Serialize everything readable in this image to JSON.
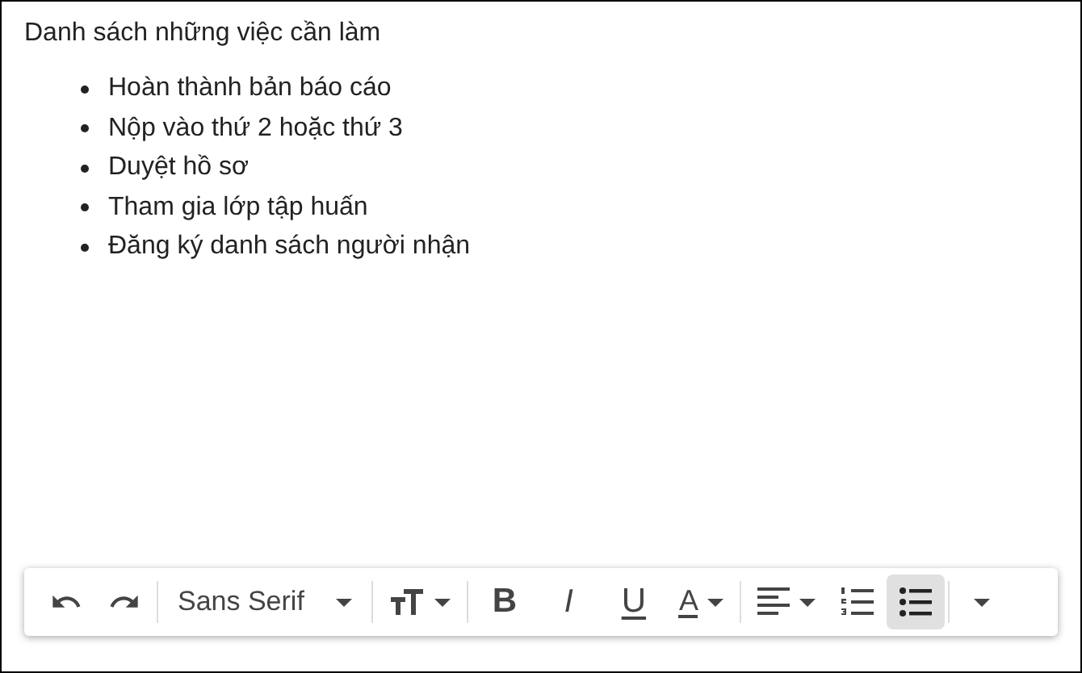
{
  "message": {
    "heading": "Danh sách những việc cần làm",
    "items": [
      "Hoàn thành bản báo cáo",
      "Nộp vào thứ 2 hoặc thứ 3",
      "Duyệt hồ sơ",
      "Tham gia lớp tập huấn",
      "Đăng ký danh sách người nhận"
    ]
  },
  "toolbar": [
    [
      {
        "kind": "undo"
      },
      {
        "kind": "redo"
      }
    ],
    [
      {
        "kind": "font",
        "label": "Sans Serif"
      }
    ],
    [
      {
        "kind": "size"
      }
    ],
    [
      {
        "kind": "bold",
        "glyph": "B"
      },
      {
        "kind": "italic",
        "glyph": "I"
      },
      {
        "kind": "underline",
        "glyph": "U"
      },
      {
        "kind": "color",
        "glyph": "A"
      }
    ],
    [
      {
        "kind": "align"
      },
      {
        "kind": "numbered",
        "selected": false
      },
      {
        "kind": "bulleted",
        "selected": true
      }
    ],
    [
      {
        "kind": "more"
      }
    ]
  ]
}
